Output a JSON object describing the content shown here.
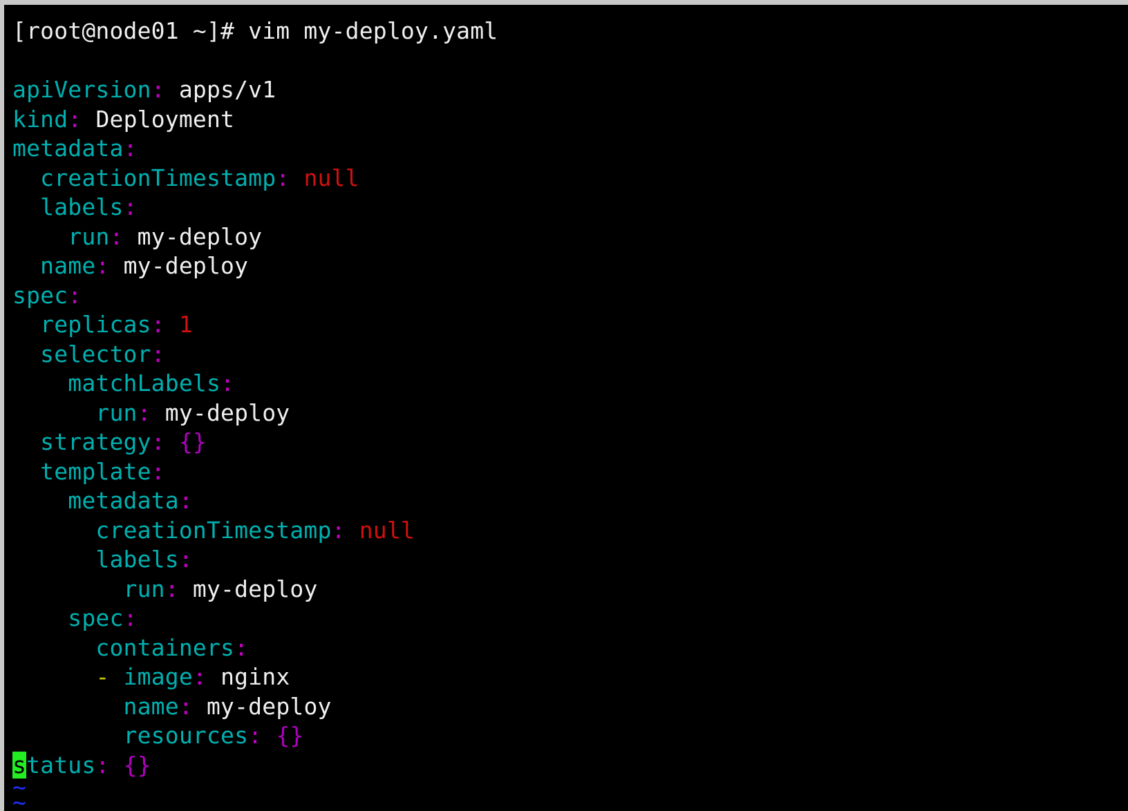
{
  "terminal": {
    "prompt": "[root@node01 ~]# vim my-deploy.yaml",
    "colors": {
      "key": "#00b0b0",
      "colon": "#c000c0",
      "value": "#f0f0f0",
      "null": "#d01010",
      "brace": "#b000c0",
      "dash": "#c8c800",
      "tilde": "#2030ff",
      "cursor": "#22ee22"
    },
    "lines": [
      {
        "indent": 0,
        "key": "apiVersion",
        "value": "apps/v1",
        "type": "str"
      },
      {
        "indent": 0,
        "key": "kind",
        "value": "Deployment",
        "type": "str"
      },
      {
        "indent": 0,
        "key": "metadata",
        "value": "",
        "type": "none"
      },
      {
        "indent": 1,
        "key": "creationTimestamp",
        "value": "null",
        "type": "null"
      },
      {
        "indent": 1,
        "key": "labels",
        "value": "",
        "type": "none"
      },
      {
        "indent": 2,
        "key": "run",
        "value": "my-deploy",
        "type": "str"
      },
      {
        "indent": 1,
        "key": "name",
        "value": "my-deploy",
        "type": "str"
      },
      {
        "indent": 0,
        "key": "spec",
        "value": "",
        "type": "none"
      },
      {
        "indent": 1,
        "key": "replicas",
        "value": "1",
        "type": "null"
      },
      {
        "indent": 1,
        "key": "selector",
        "value": "",
        "type": "none"
      },
      {
        "indent": 2,
        "key": "matchLabels",
        "value": "",
        "type": "none"
      },
      {
        "indent": 3,
        "key": "run",
        "value": "my-deploy",
        "type": "str"
      },
      {
        "indent": 1,
        "key": "strategy",
        "value": "{}",
        "type": "brace"
      },
      {
        "indent": 1,
        "key": "template",
        "value": "",
        "type": "none"
      },
      {
        "indent": 2,
        "key": "metadata",
        "value": "",
        "type": "none"
      },
      {
        "indent": 3,
        "key": "creationTimestamp",
        "value": "null",
        "type": "null"
      },
      {
        "indent": 3,
        "key": "labels",
        "value": "",
        "type": "none"
      },
      {
        "indent": 4,
        "key": "run",
        "value": "my-deploy",
        "type": "str"
      },
      {
        "indent": 2,
        "key": "spec",
        "value": "",
        "type": "none"
      },
      {
        "indent": 3,
        "key": "containers",
        "value": "",
        "type": "none"
      },
      {
        "indent": 3,
        "dash": "-",
        "key": "image",
        "value": "nginx",
        "type": "str"
      },
      {
        "indent": 4,
        "key": "name",
        "value": "my-deploy",
        "type": "str"
      },
      {
        "indent": 4,
        "key": "resources",
        "value": "{}",
        "type": "brace"
      },
      {
        "indent": 0,
        "key": "status",
        "value": "{}",
        "type": "brace",
        "cursor": true
      }
    ],
    "tilde_lines": [
      "~",
      "~"
    ]
  }
}
